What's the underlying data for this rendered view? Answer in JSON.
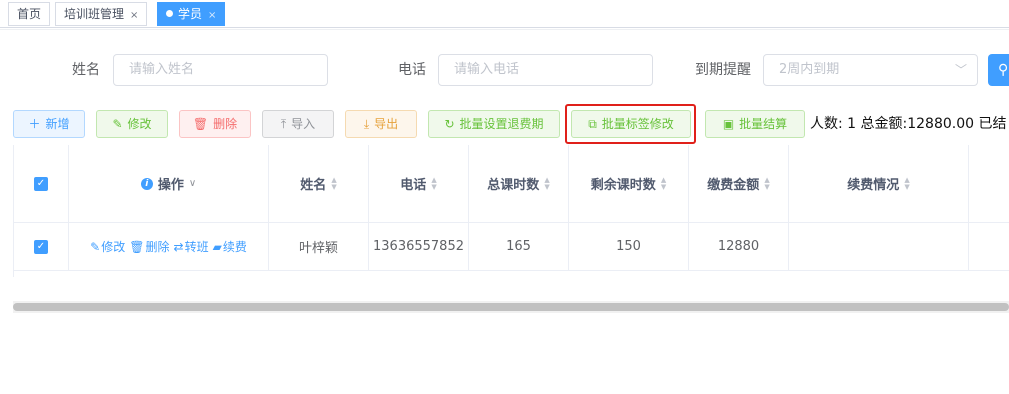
{
  "tabs": [
    {
      "label": "首页",
      "active": false,
      "closable": false
    },
    {
      "label": "培训班管理",
      "active": false,
      "closable": true
    },
    {
      "label": "学员",
      "active": true,
      "closable": true
    }
  ],
  "search": {
    "name_label": "姓名",
    "name_placeholder": "请输入姓名",
    "phone_label": "电话",
    "phone_placeholder": "请输入电话",
    "expire_label": "到期提醒",
    "expire_value": "2周内到期"
  },
  "toolbar": {
    "add": "新增",
    "edit": "修改",
    "delete": "删除",
    "import": "导入",
    "export": "导出",
    "batch_refund": "批量设置退费期",
    "batch_tag": "批量标签修改",
    "batch_settle": "批量结算",
    "summary": "人数: 1 总金额:12880.00 已结"
  },
  "table": {
    "headers": {
      "action": "操作",
      "name": "姓名",
      "phone": "电话",
      "total_hours": "总课时数",
      "remaining_hours": "剩余课时数",
      "amount": "缴费金额",
      "renewal": "续费情况"
    },
    "row_actions": [
      "修改",
      "删除",
      "转班",
      "续费"
    ],
    "rows": [
      {
        "name": "叶梓颖",
        "phone": "13636557852",
        "total_hours": "165",
        "remaining_hours": "150",
        "amount": "12880",
        "renewal": ""
      }
    ]
  },
  "colors": {
    "primary": "#409eff",
    "highlight": "#e0201a"
  }
}
